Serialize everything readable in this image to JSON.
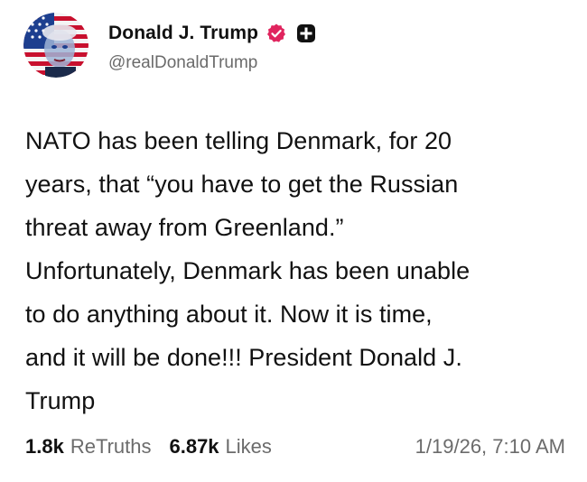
{
  "author": {
    "display_name": "Donald J. Trump",
    "handle": "@realDonaldTrump",
    "avatar_icon": "flag-portrait-avatar",
    "verified_icon": "verified-badge-icon",
    "plus_icon": "plus-badge-icon"
  },
  "post": {
    "text": "NATO has been telling Denmark, for 20\nyears, that “you have to get the Russian\nthreat away from Greenland.”\nUnfortunately, Denmark has been unable\nto do anything about it. Now it is time,\nand it will be done!!! President Donald J.\nTrump"
  },
  "stats": {
    "retruths_count": "1.8k",
    "retruths_label": "ReTruths",
    "likes_count": "6.87k",
    "likes_label": "Likes",
    "timestamp": "1/19/26, 7:10 AM"
  },
  "colors": {
    "verified": "#e0245e",
    "text_primary": "#111111",
    "text_secondary": "#6b6b6b",
    "flag_red": "#c8102e",
    "flag_blue": "#1d3f8f"
  }
}
